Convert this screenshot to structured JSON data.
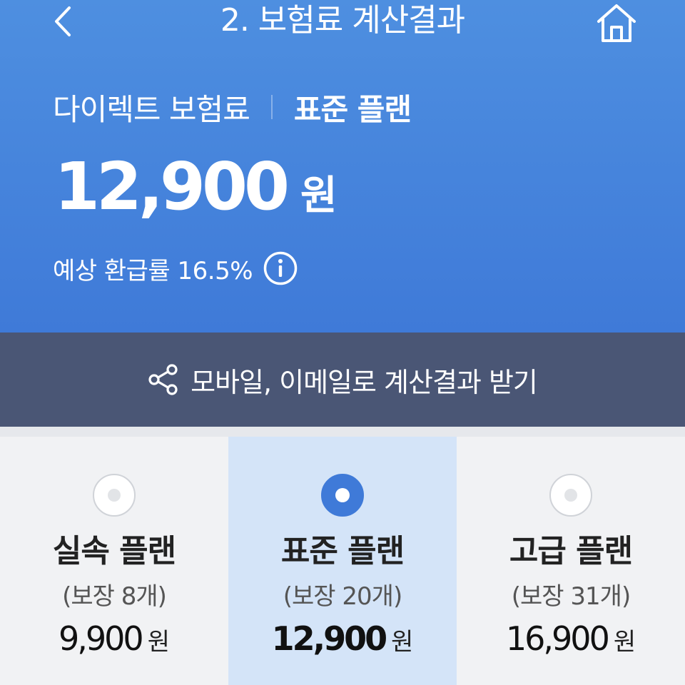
{
  "header": {
    "title": "2. 보험료 계산결과",
    "back_icon": "chevron-left-icon",
    "home_icon": "home-icon"
  },
  "summary": {
    "product_label": "다이렉트 보험료",
    "plan_name": "표준 플랜",
    "amount": "12,900",
    "unit": "원",
    "refund_text": "예상 환급률 16.5%"
  },
  "share": {
    "label": "모바일, 이메일로 계산결과 받기",
    "icon": "share-icon"
  },
  "plans": [
    {
      "name": "실속 플랜",
      "coverage": "(보장 8개)",
      "amount": "9,900",
      "unit": "원",
      "selected": false
    },
    {
      "name": "표준 플랜",
      "coverage": "(보장 20개)",
      "amount": "12,900",
      "unit": "원",
      "selected": true
    },
    {
      "name": "고급 플랜",
      "coverage": "(보장 31개)",
      "amount": "16,900",
      "unit": "원",
      "selected": false
    }
  ],
  "colors": {
    "hero": "#4585dc",
    "share_bar": "#4a5675",
    "selected_card": "#d4e4f8",
    "accent": "#3f7ad8"
  }
}
